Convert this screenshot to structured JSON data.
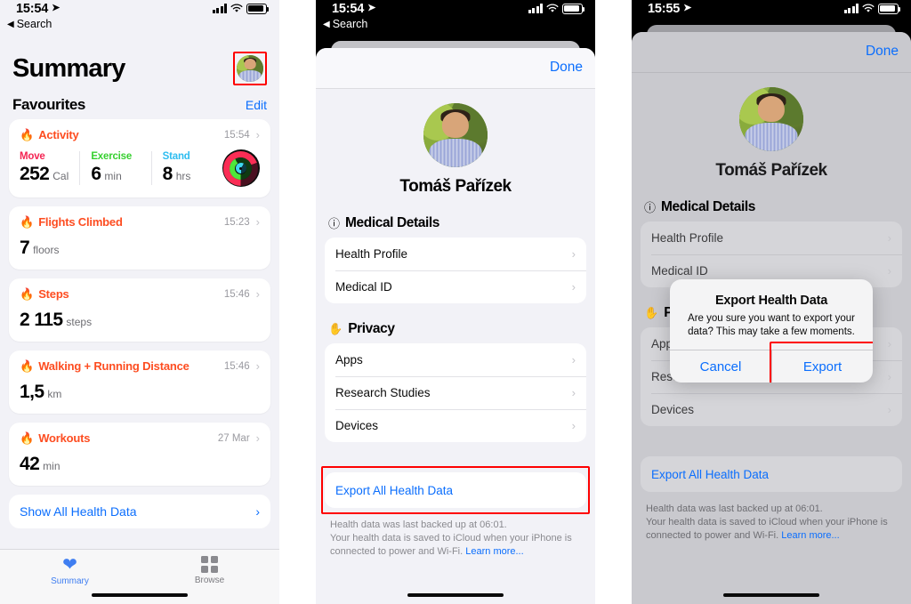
{
  "panel1": {
    "status": {
      "time": "15:54",
      "back_label": "Search",
      "location_arrow": "➤"
    },
    "page_title": "Summary",
    "section_title": "Favourites",
    "section_action": "Edit",
    "activity_card": {
      "name": "Activity",
      "time": "15:54",
      "metrics": [
        {
          "label": "Move",
          "value": "252",
          "unit": "Cal"
        },
        {
          "label": "Exercise",
          "value": "6",
          "unit": "min"
        },
        {
          "label": "Stand",
          "value": "8",
          "unit": "hrs"
        }
      ]
    },
    "cards": [
      {
        "name": "Flights Climbed",
        "time": "15:23",
        "value": "7",
        "unit": "floors"
      },
      {
        "name": "Steps",
        "time": "15:46",
        "value": "2 115",
        "unit": "steps"
      },
      {
        "name": "Walking + Running Distance",
        "time": "15:46",
        "value": "1,5",
        "unit": "km"
      },
      {
        "name": "Workouts",
        "time": "27 Mar",
        "value": "42",
        "unit": "min"
      }
    ],
    "show_all": "Show All Health Data",
    "tabs": [
      {
        "label": "Summary",
        "icon": "heart-icon",
        "active": true
      },
      {
        "label": "Browse",
        "icon": "grid-icon",
        "active": false
      }
    ]
  },
  "panel2": {
    "status": {
      "time": "15:54",
      "back_label": "Search"
    },
    "nav_done": "Done",
    "profile_name": "Tomáš Pařízek",
    "groups": [
      {
        "title": "Medical Details",
        "icon": "info-icon",
        "items": [
          "Health Profile",
          "Medical ID"
        ]
      },
      {
        "title": "Privacy",
        "icon": "hand-raised-icon",
        "items": [
          "Apps",
          "Research Studies",
          "Devices"
        ]
      }
    ],
    "export_action": "Export All Health Data",
    "footnote_line1": "Health data was last backed up at 06:01.",
    "footnote_line2": "Your health data is saved to iCloud when your iPhone is",
    "footnote_line3": "connected to power and Wi-Fi. ",
    "footnote_link": "Learn more..."
  },
  "panel3": {
    "status": {
      "time": "15:55"
    },
    "nav_done": "Done",
    "profile_name": "Tomáš Pařízek",
    "groups": [
      {
        "title": "Medical Details",
        "icon": "info-icon",
        "items": [
          "Health Profile",
          "Medical ID"
        ]
      },
      {
        "title": "Privacy",
        "icon": "hand-raised-icon",
        "items": [
          "Apps",
          "Research Studies",
          "Devices"
        ]
      }
    ],
    "export_action": "Export All Health Data",
    "footnote_line1": "Health data was last backed up at 06:01.",
    "footnote_line2": "Your health data is saved to iCloud when your iPhone is",
    "footnote_line3": "connected to power and Wi-Fi. ",
    "footnote_link": "Learn more...",
    "alert": {
      "title": "Export Health Data",
      "message": "Are you sure you want to export your data? This may take a few moments.",
      "cancel_label": "Cancel",
      "confirm_label": "Export"
    }
  },
  "colors": {
    "highlight": "#fe0000",
    "link": "#0b6efd",
    "health_orange": "#fd4d21",
    "move_red": "#f42553",
    "exercise_green": "#37d030",
    "stand_blue": "#2fbdf0",
    "page_bg": "#f2f2f7"
  }
}
